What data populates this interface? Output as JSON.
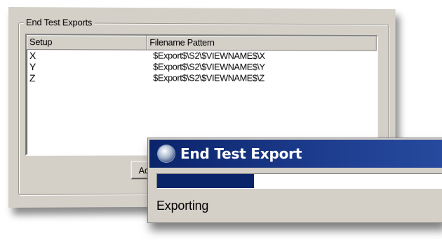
{
  "exports_panel": {
    "group_title": "End Test Exports",
    "columns": [
      "Setup",
      "Filename Pattern"
    ],
    "rows": [
      {
        "setup": "X",
        "pattern": "$Export$\\S2\\$VIEWNAME$\\X"
      },
      {
        "setup": "Y",
        "pattern": "$Export$\\S2\\$VIEWNAME$\\Y"
      },
      {
        "setup": "Z",
        "pattern": "$Export$\\S2\\$VIEWNAME$\\Z"
      }
    ],
    "add_button_label": "Ad"
  },
  "progress_dialog": {
    "title": "End Test Export",
    "icon": "globe-app-icon",
    "progress_fraction": 0.34,
    "status": "Exporting",
    "accent_color": "#0a246a"
  }
}
